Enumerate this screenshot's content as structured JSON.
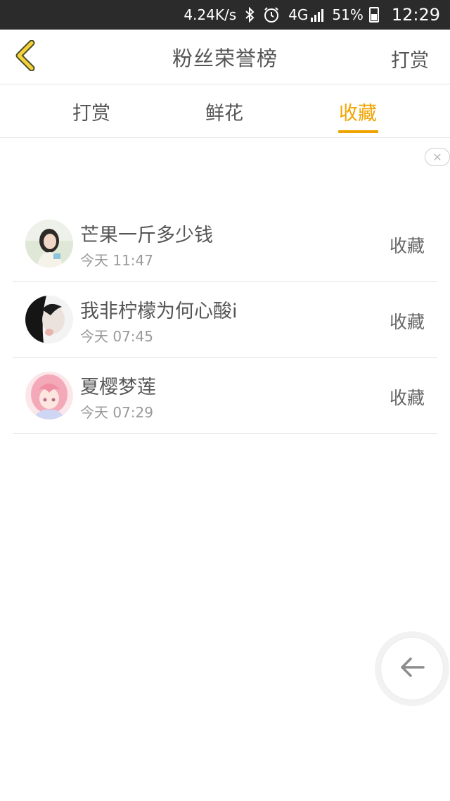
{
  "status_bar": {
    "net_speed": "4.24K/s",
    "network": "4G",
    "battery": "51%",
    "time": "12:29"
  },
  "header": {
    "title": "粉丝荣誉榜",
    "action_label": "打赏"
  },
  "tabs": [
    {
      "label": "打赏",
      "active": false
    },
    {
      "label": "鲜花",
      "active": false
    },
    {
      "label": "收藏",
      "active": true
    }
  ],
  "accent_color": "#f0a400",
  "fans": [
    {
      "name": "芒果一斤多少钱",
      "time": "今天 11:47",
      "badge": "收藏"
    },
    {
      "name": "我非柠檬为何心酸i",
      "time": "今天 07:45",
      "badge": "收藏"
    },
    {
      "name": "夏樱梦莲",
      "time": "今天 07:29",
      "badge": "收藏"
    }
  ],
  "icons": {
    "back": "chevron-left-icon",
    "close": "close-icon",
    "fab": "arrow-left-icon"
  }
}
